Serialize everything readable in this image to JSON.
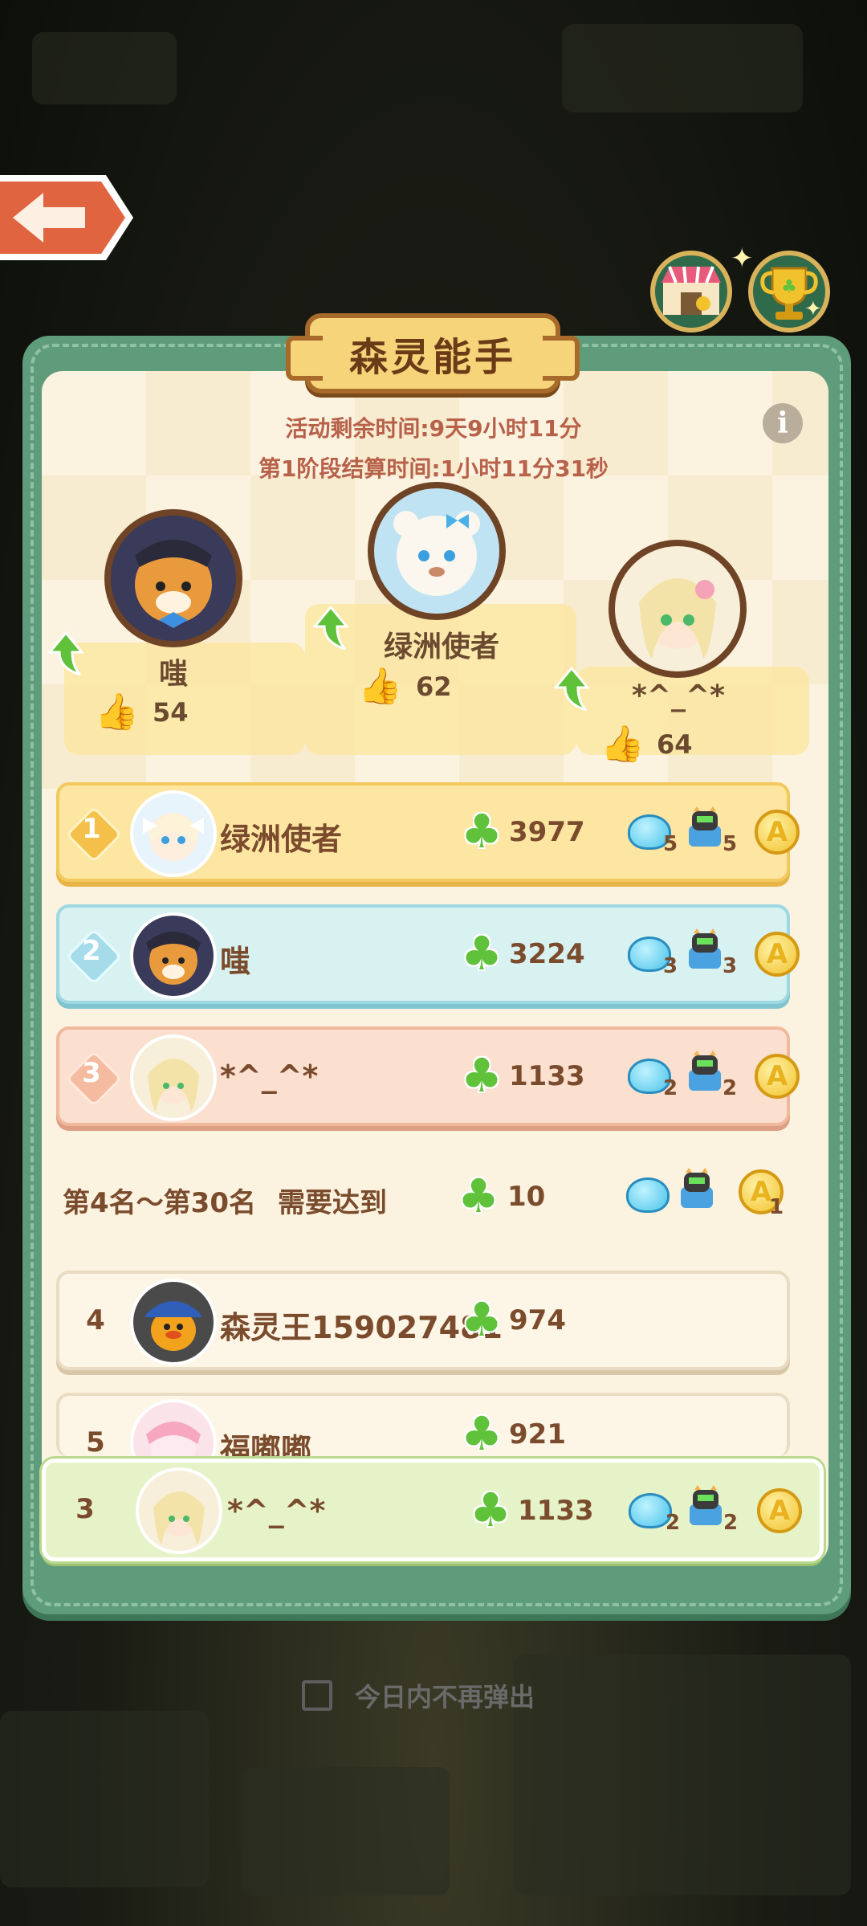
{
  "panel": {
    "title": "森灵能手",
    "activity_remaining": "活动剩余时间:9天9小时11分",
    "stage_end": "第1阶段结算时间:1小时11分31秒",
    "info_icon": "i"
  },
  "podium": [
    {
      "name": "嗤",
      "likes": "54"
    },
    {
      "name": "绿洲使者",
      "likes": "62"
    },
    {
      "name": "*^_^*",
      "likes": "64"
    }
  ],
  "leaderboard": [
    {
      "rank": "1",
      "name": "绿洲使者",
      "score": "3977",
      "slime": "5",
      "robot": "5"
    },
    {
      "rank": "2",
      "name": "嗤",
      "score": "3224",
      "slime": "3",
      "robot": "3"
    },
    {
      "rank": "3",
      "name": "*^_^*",
      "score": "1133",
      "slime": "2",
      "robot": "2"
    }
  ],
  "tier": {
    "range": "第4名～第30名",
    "requirement": "需要达到",
    "score": "10",
    "coin_count": "1"
  },
  "others": [
    {
      "rank": "4",
      "name": "森灵王159027481",
      "score": "974"
    },
    {
      "rank": "5",
      "name": "福嘟嘟",
      "score": "921"
    }
  ],
  "self_row": {
    "rank": "3",
    "name": "*^_^*",
    "score": "1133",
    "slime": "2",
    "robot": "2"
  },
  "dont_show": {
    "label": "今日内不再弹出"
  },
  "icons": {
    "back": "back-arrow-icon",
    "shop": "shop-icon",
    "trophy": "trophy-icon",
    "like": "thumbs-up-icon",
    "clover": "clover-icon",
    "slime": "slime-icon",
    "robot": "robot-icon",
    "coin": "coin-icon"
  },
  "colors": {
    "panel_green": "#5f9c7b",
    "gold_row": "#fde6a2",
    "blue_row": "#d8f1f1",
    "pink_row": "#fbdfcf",
    "self_row": "#e6f3c8"
  }
}
